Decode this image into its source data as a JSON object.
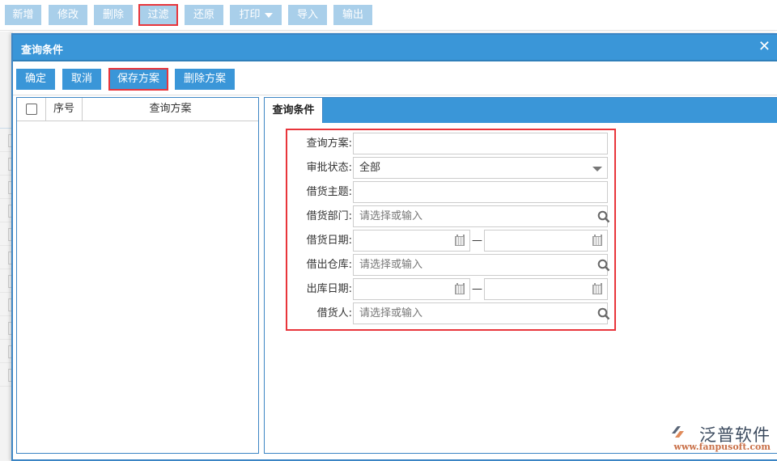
{
  "toolbar": {
    "buttons": [
      {
        "label": "新增"
      },
      {
        "label": "修改"
      },
      {
        "label": "删除"
      },
      {
        "label": "过滤",
        "highlighted": true
      },
      {
        "label": "还原"
      },
      {
        "label": "打印",
        "has_dropdown": true
      },
      {
        "label": "导入"
      },
      {
        "label": "输出"
      }
    ]
  },
  "dialog": {
    "title": "查询条件",
    "close_icon": "close-icon",
    "actions": {
      "confirm": "确定",
      "cancel": "取消",
      "save_scheme": "保存方案",
      "delete_scheme": "删除方案"
    },
    "scheme_grid": {
      "columns": [
        "",
        "序号",
        "查询方案"
      ],
      "rows": []
    },
    "tabs": [
      {
        "label": "查询条件",
        "active": true
      }
    ],
    "form": {
      "fields": [
        {
          "label": "查询方案:",
          "type": "text",
          "value": "",
          "placeholder": ""
        },
        {
          "label": "审批状态:",
          "type": "select",
          "value": "全部"
        },
        {
          "label": "借货主题:",
          "type": "text",
          "value": "",
          "placeholder": ""
        },
        {
          "label": "借货部门:",
          "type": "lookup",
          "value": "",
          "placeholder": "请选择或输入"
        },
        {
          "label": "借货日期:",
          "type": "date-range",
          "from": "",
          "to": "",
          "separator": "—"
        },
        {
          "label": "借出仓库:",
          "type": "lookup",
          "value": "",
          "placeholder": "请选择或输入"
        },
        {
          "label": "出库日期:",
          "type": "date-range",
          "from": "",
          "to": "",
          "separator": "—"
        },
        {
          "label": "借货人:",
          "type": "lookup",
          "value": "",
          "placeholder": "请选择或输入"
        }
      ]
    }
  },
  "watermark": {
    "name": "泛普软件",
    "url": "www.fanpusoft.com"
  },
  "colors": {
    "primary": "#3a96d8",
    "toolbar_button": "#a9cfea",
    "highlight": "#e8353b",
    "border": "#3c85c4"
  }
}
